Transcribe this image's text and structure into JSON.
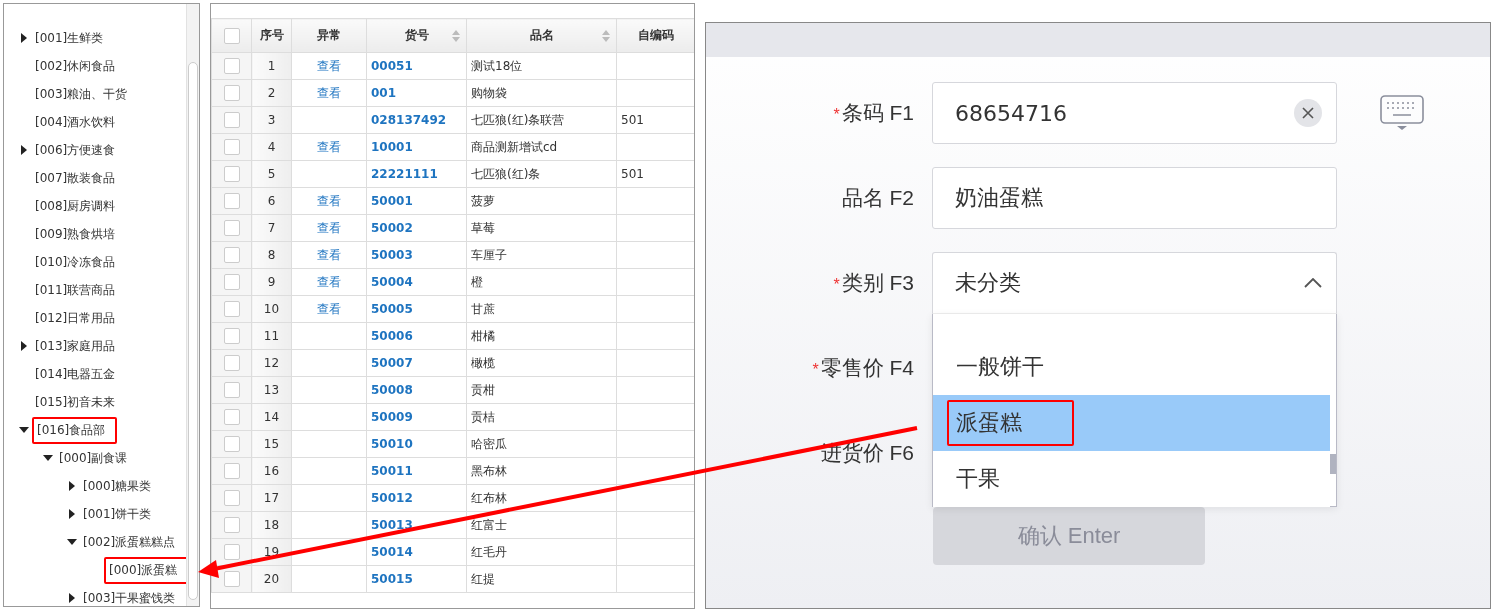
{
  "tree": {
    "items": [
      {
        "label": "[001]生鲜类",
        "has_children": true,
        "expanded": false,
        "highlighted": false
      },
      {
        "label": "[002]休闲食品",
        "has_children": false,
        "highlighted": false
      },
      {
        "label": "[003]粮油、干货",
        "has_children": false,
        "highlighted": false
      },
      {
        "label": "[004]酒水饮料",
        "has_children": false,
        "highlighted": false
      },
      {
        "label": "[006]方便速食",
        "has_children": true,
        "expanded": false,
        "highlighted": false
      },
      {
        "label": "[007]散装食品",
        "has_children": false,
        "highlighted": false
      },
      {
        "label": "[008]厨房调料",
        "has_children": false,
        "highlighted": false
      },
      {
        "label": "[009]熟食烘培",
        "has_children": false,
        "highlighted": false
      },
      {
        "label": "[010]冷冻食品",
        "has_children": false,
        "highlighted": false
      },
      {
        "label": "[011]联营商品",
        "has_children": false,
        "highlighted": false
      },
      {
        "label": "[012]日常用品",
        "has_children": false,
        "highlighted": false
      },
      {
        "label": "[013]家庭用品",
        "has_children": true,
        "expanded": false,
        "highlighted": false
      },
      {
        "label": "[014]电器五金",
        "has_children": false,
        "highlighted": false
      },
      {
        "label": "[015]初音未来",
        "has_children": false,
        "highlighted": false
      },
      {
        "label": "[016]食品部",
        "has_children": true,
        "expanded": true,
        "highlighted": true,
        "children": [
          {
            "label": "[000]副食课",
            "has_children": true,
            "expanded": true,
            "highlighted": false,
            "children": [
              {
                "label": "[000]糖果类",
                "has_children": true,
                "expanded": false,
                "highlighted": false
              },
              {
                "label": "[001]饼干类",
                "has_children": true,
                "expanded": false,
                "highlighted": false
              },
              {
                "label": "[002]派蛋糕糕点",
                "has_children": true,
                "expanded": true,
                "highlighted": false,
                "children": [
                  {
                    "label": "[000]派蛋糕",
                    "has_children": false,
                    "highlighted": true
                  }
                ]
              },
              {
                "label": "[003]干果蜜饯类",
                "has_children": true,
                "expanded": false,
                "highlighted": false
              }
            ]
          }
        ]
      }
    ]
  },
  "table": {
    "header_checked": false,
    "columns": [
      {
        "label": "序号",
        "sortable": false
      },
      {
        "label": "异常",
        "sortable": false
      },
      {
        "label": "货号",
        "sortable": true
      },
      {
        "label": "品名",
        "sortable": true
      },
      {
        "label": "自编码",
        "sortable": false
      }
    ],
    "rows": [
      {
        "checked": false,
        "no": "1",
        "abnormal": "查看",
        "code": "00051",
        "name": "测试18位",
        "own_code": ""
      },
      {
        "checked": false,
        "no": "2",
        "abnormal": "查看",
        "code": "001",
        "name": "购物袋",
        "own_code": ""
      },
      {
        "checked": false,
        "no": "3",
        "abnormal": "",
        "code": "028137492",
        "name": "七匹狼(红)条联营",
        "own_code": "501"
      },
      {
        "checked": false,
        "no": "4",
        "abnormal": "查看",
        "code": "10001",
        "name": "商品测新增试cd",
        "own_code": ""
      },
      {
        "checked": false,
        "no": "5",
        "abnormal": "",
        "code": "22221111",
        "name": "七匹狼(红)条",
        "own_code": "501"
      },
      {
        "checked": false,
        "no": "6",
        "abnormal": "查看",
        "code": "50001",
        "name": "菠萝",
        "own_code": ""
      },
      {
        "checked": false,
        "no": "7",
        "abnormal": "查看",
        "code": "50002",
        "name": "草莓",
        "own_code": ""
      },
      {
        "checked": false,
        "no": "8",
        "abnormal": "查看",
        "code": "50003",
        "name": "车厘子",
        "own_code": ""
      },
      {
        "checked": false,
        "no": "9",
        "abnormal": "查看",
        "code": "50004",
        "name": "橙",
        "own_code": ""
      },
      {
        "checked": false,
        "no": "10",
        "abnormal": "查看",
        "code": "50005",
        "name": "甘蔗",
        "own_code": ""
      },
      {
        "checked": false,
        "no": "11",
        "abnormal": "",
        "code": "50006",
        "name": "柑橘",
        "own_code": ""
      },
      {
        "checked": false,
        "no": "12",
        "abnormal": "",
        "code": "50007",
        "name": "橄榄",
        "own_code": ""
      },
      {
        "checked": false,
        "no": "13",
        "abnormal": "",
        "code": "50008",
        "name": "贡柑",
        "own_code": ""
      },
      {
        "checked": false,
        "no": "14",
        "abnormal": "",
        "code": "50009",
        "name": "贡桔",
        "own_code": ""
      },
      {
        "checked": false,
        "no": "15",
        "abnormal": "",
        "code": "50010",
        "name": "哈密瓜",
        "own_code": ""
      },
      {
        "checked": false,
        "no": "16",
        "abnormal": "",
        "code": "50011",
        "name": "黑布林",
        "own_code": ""
      },
      {
        "checked": false,
        "no": "17",
        "abnormal": "",
        "code": "50012",
        "name": "红布林",
        "own_code": ""
      },
      {
        "checked": false,
        "no": "18",
        "abnormal": "",
        "code": "50013",
        "name": "红富士",
        "own_code": ""
      },
      {
        "checked": false,
        "no": "19",
        "abnormal": "",
        "code": "50014",
        "name": "红毛丹",
        "own_code": ""
      },
      {
        "checked": false,
        "no": "20",
        "abnormal": "",
        "code": "50015",
        "name": "红提",
        "own_code": ""
      }
    ]
  },
  "form": {
    "fields": [
      {
        "kind": "input",
        "required_mark": "*",
        "label": "条码 F1",
        "value": "68654716",
        "clearable": true
      },
      {
        "kind": "input",
        "label": "品名 F2",
        "value": "奶油蛋糕",
        "clearable": false
      },
      {
        "kind": "select",
        "required_mark": "*",
        "label": "类别 F3",
        "value": "未分类",
        "expanded": true,
        "options": [
          {
            "label": "一般饼干",
            "selected": false,
            "highlighted": false
          },
          {
            "label": "派蛋糕",
            "selected": true,
            "highlighted": true
          },
          {
            "label": "干果",
            "selected": false,
            "highlighted": false
          }
        ]
      },
      {
        "kind": "covered",
        "required_mark": "*",
        "label": "零售价 F4"
      },
      {
        "kind": "covered",
        "label": "进货价 F6"
      }
    ],
    "confirm_button": {
      "label": "确认 Enter",
      "disabled": true
    }
  }
}
